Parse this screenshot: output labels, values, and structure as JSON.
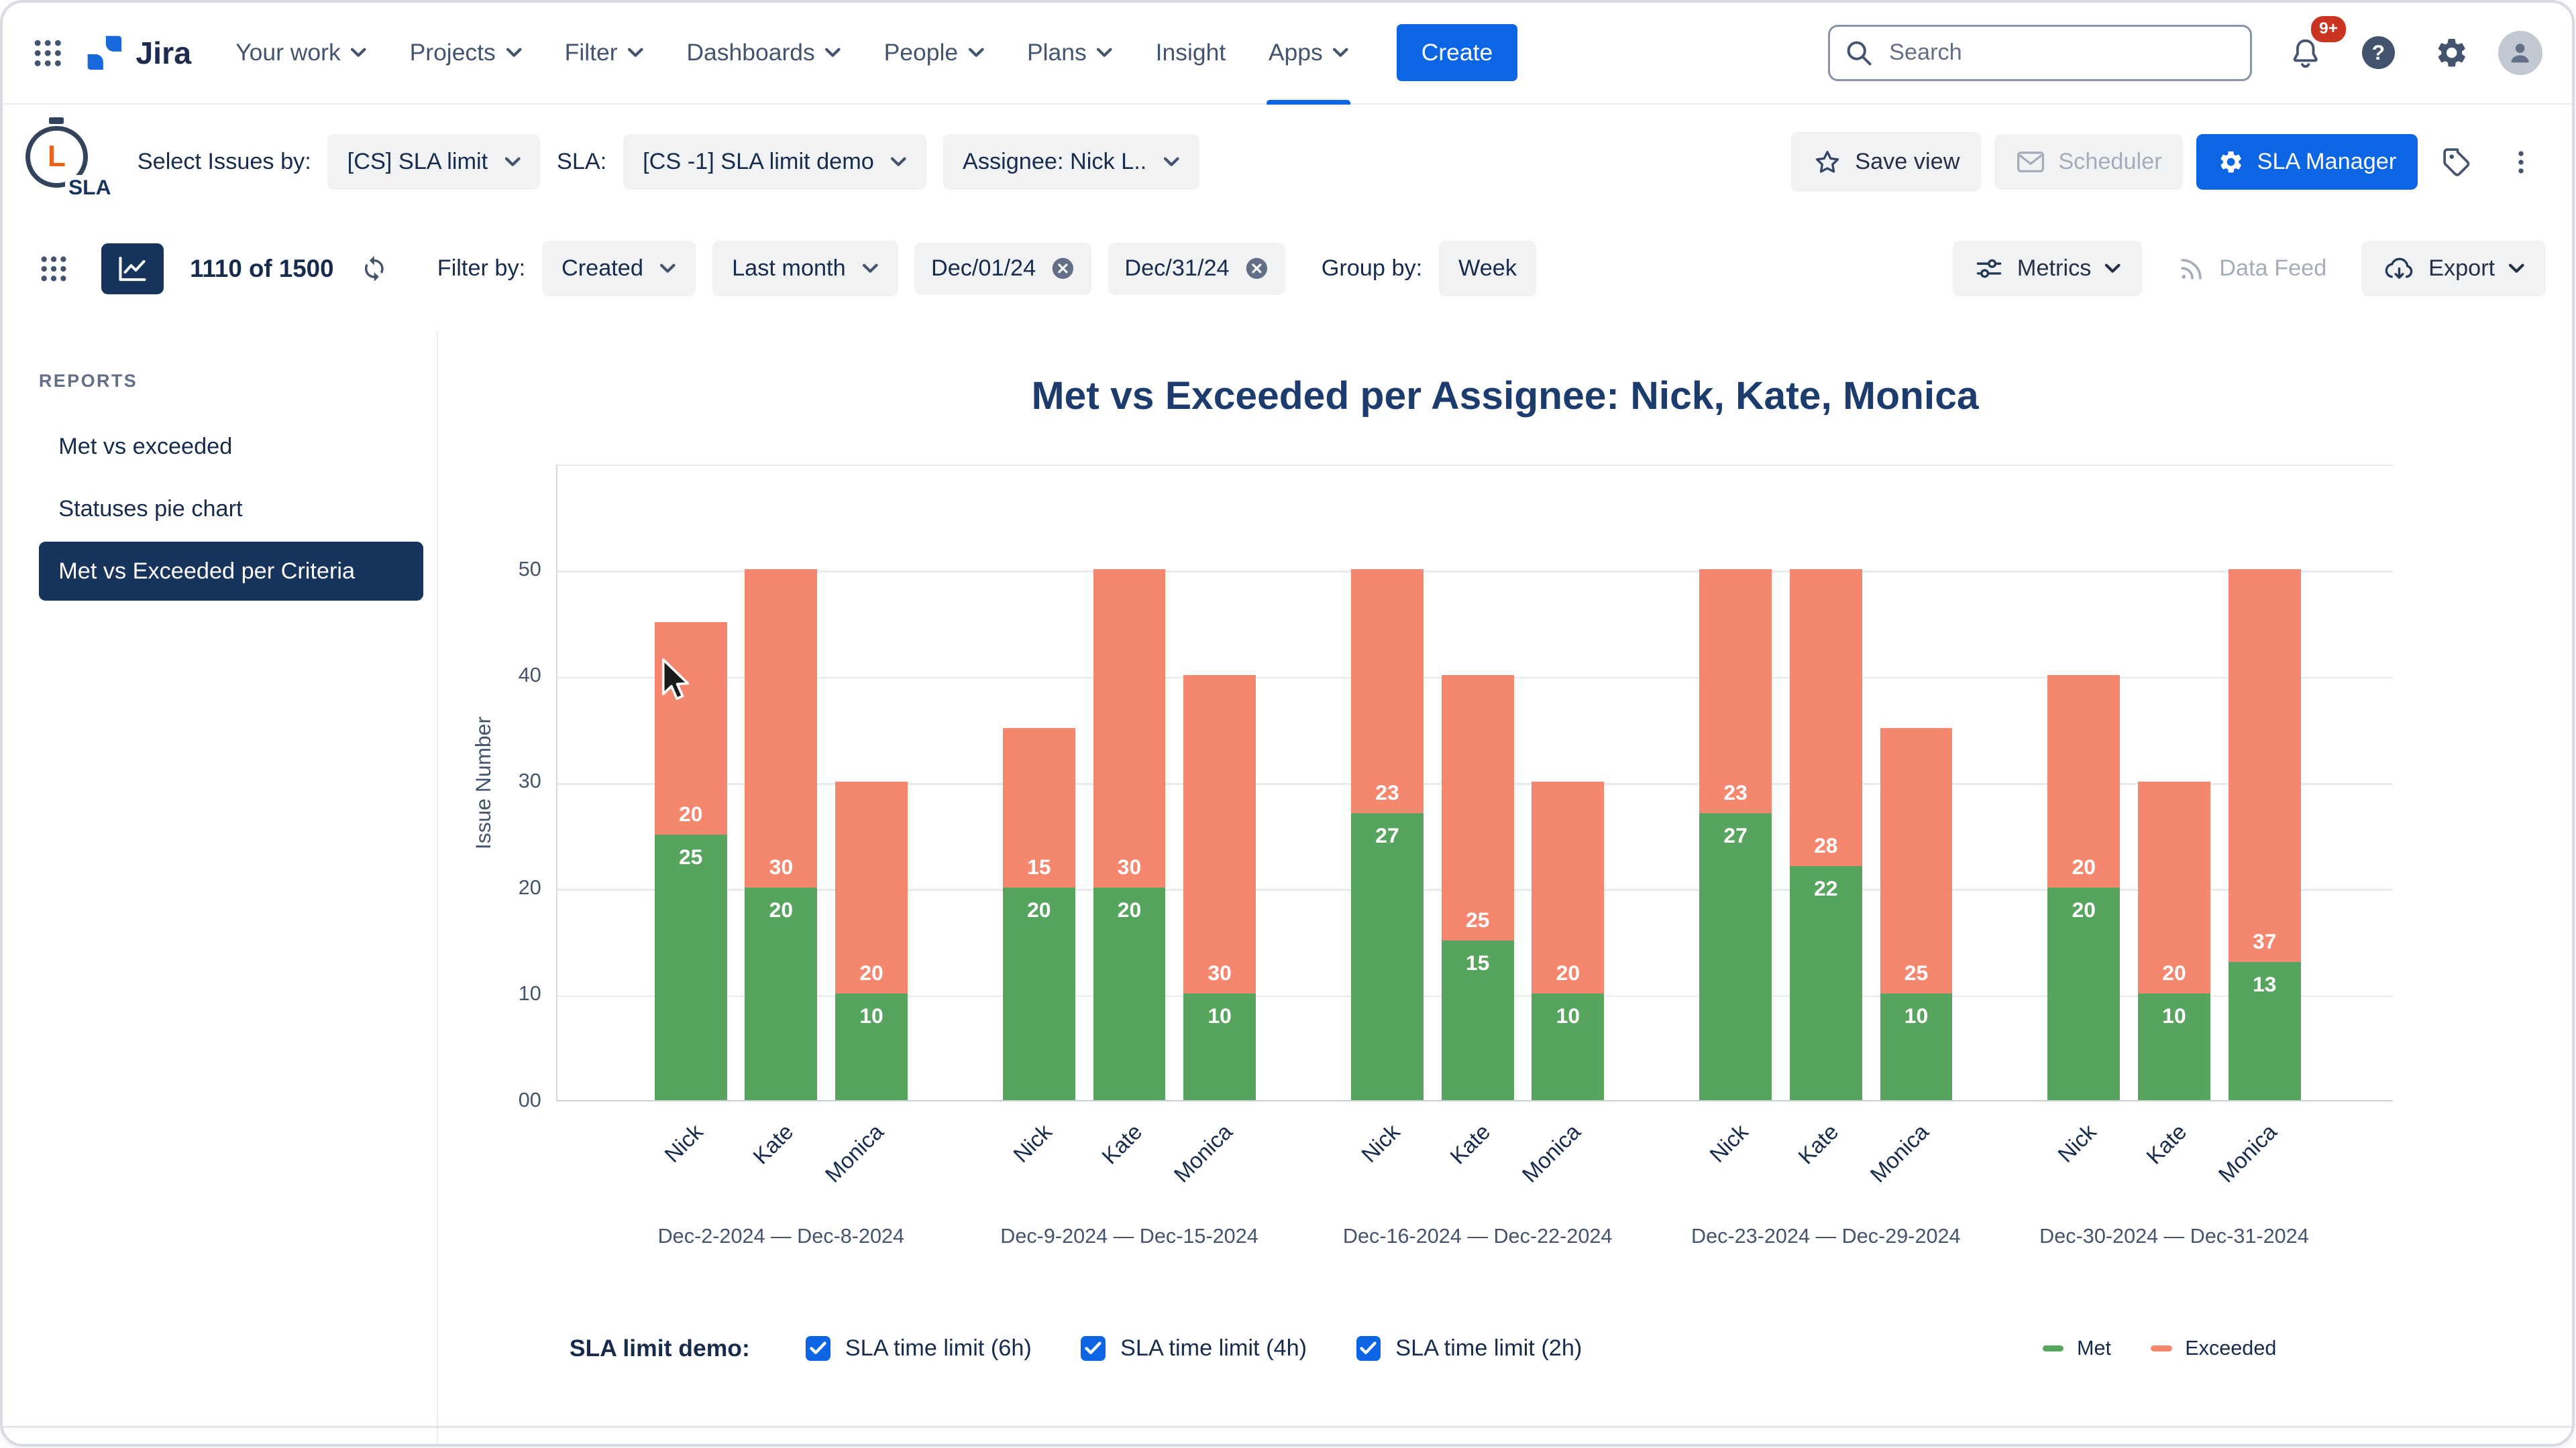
{
  "colors": {
    "accent": "#0C66E4",
    "navy": "#17345C",
    "badge": "#CA3521",
    "met": "#57A45F",
    "exceeded": "#F4876E"
  },
  "topnav": {
    "logo_text": "Jira",
    "menu": [
      {
        "label": "Your work",
        "chevron": true
      },
      {
        "label": "Projects",
        "chevron": true
      },
      {
        "label": "Filter",
        "chevron": true
      },
      {
        "label": "Dashboards",
        "chevron": true
      },
      {
        "label": "People",
        "chevron": true
      },
      {
        "label": "Plans",
        "chevron": true
      },
      {
        "label": "Insight",
        "chevron": false
      },
      {
        "label": "Apps",
        "chevron": true,
        "active": true
      }
    ],
    "create_label": "Create",
    "search_placeholder": "Search",
    "notifications_badge": "9+"
  },
  "sla_bar": {
    "logo_text": "SLA",
    "select_issues_label": "Select Issues by:",
    "select_issues_value": "[CS] SLA limit",
    "sla_label": "SLA:",
    "sla_value": "[CS -1] SLA limit demo",
    "assignee_value": "Assignee: Nick L..",
    "save_view_label": "Save view",
    "scheduler_label": "Scheduler",
    "sla_manager_label": "SLA Manager"
  },
  "toolbar": {
    "count": "1110 of 1500",
    "filter_by_label": "Filter by:",
    "filter_field": "Created",
    "period": "Last month",
    "date_from": "Dec/01/24",
    "date_to": "Dec/31/24",
    "group_by_label": "Group by:",
    "group_by_value": "Week",
    "metrics_label": "Metrics",
    "data_feed_label": "Data Feed",
    "export_label": "Export"
  },
  "sidebar": {
    "header": "REPORTS",
    "items": [
      {
        "label": "Met vs exceeded",
        "selected": false
      },
      {
        "label": "Statuses pie chart",
        "selected": false
      },
      {
        "label": "Met vs Exceeded per Criteria",
        "selected": true
      }
    ]
  },
  "chart_data": {
    "type": "bar",
    "stacked": true,
    "title": "Met vs Exceeded per Assignee: Nick, Kate, Monica",
    "ylabel": "Issue Number",
    "ylim": [
      0,
      60
    ],
    "yticks": [
      "00",
      "10",
      "20",
      "30",
      "40",
      "50"
    ],
    "grid": true,
    "legend_position": "bottom-right",
    "series_labels": [
      "Met",
      "Exceeded"
    ],
    "colors": {
      "met": "#57A45F",
      "exceeded": "#F4876E"
    },
    "groups": [
      {
        "range": "Dec-2-2024 — Dec-8-2024",
        "bars": [
          {
            "assignee": "Nick",
            "met": 25,
            "exceeded": 20
          },
          {
            "assignee": "Kate",
            "met": 20,
            "exceeded": 30
          },
          {
            "assignee": "Monica",
            "met": 10,
            "exceeded": 20
          }
        ]
      },
      {
        "range": "Dec-9-2024 — Dec-15-2024",
        "bars": [
          {
            "assignee": "Nick",
            "met": 20,
            "exceeded": 15
          },
          {
            "assignee": "Kate",
            "met": 20,
            "exceeded": 30
          },
          {
            "assignee": "Monica",
            "met": 10,
            "exceeded": 30
          }
        ]
      },
      {
        "range": "Dec-16-2024 — Dec-22-2024",
        "bars": [
          {
            "assignee": "Nick",
            "met": 27,
            "exceeded": 23
          },
          {
            "assignee": "Kate",
            "met": 15,
            "exceeded": 25
          },
          {
            "assignee": "Monica",
            "met": 10,
            "exceeded": 20
          }
        ]
      },
      {
        "range": "Dec-23-2024 — Dec-29-2024",
        "bars": [
          {
            "assignee": "Nick",
            "met": 27,
            "exceeded": 23
          },
          {
            "assignee": "Kate",
            "met": 22,
            "exceeded": 28
          },
          {
            "assignee": "Monica",
            "met": 10,
            "exceeded": 25
          }
        ]
      },
      {
        "range": "Dec-30-2024 — Dec-31-2024",
        "bars": [
          {
            "assignee": "Nick",
            "met": 20,
            "exceeded": 20
          },
          {
            "assignee": "Kate",
            "met": 10,
            "exceeded": 20
          },
          {
            "assignee": "Monica",
            "met": 13,
            "exceeded": 37
          }
        ]
      }
    ],
    "legend": [
      {
        "label": "Met",
        "color": "#57A45F"
      },
      {
        "label": "Exceeded",
        "color": "#F4876E"
      }
    ]
  },
  "footer": {
    "label": "SLA limit demo:",
    "checkboxes": [
      {
        "label": "SLA time limit (6h)",
        "checked": true
      },
      {
        "label": "SLA time limit (4h)",
        "checked": true
      },
      {
        "label": "SLA time limit (2h)",
        "checked": true
      }
    ]
  }
}
